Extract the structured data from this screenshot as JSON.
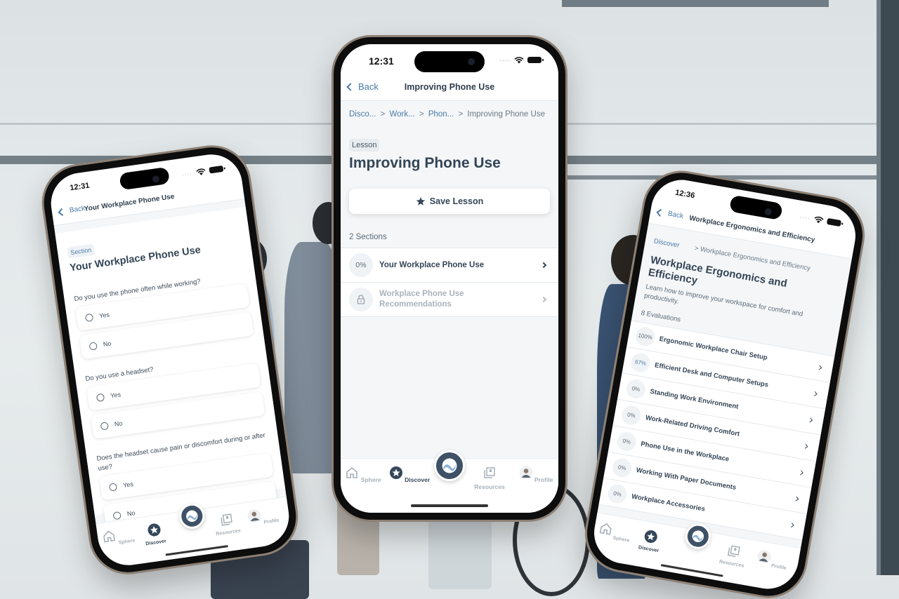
{
  "colors": {
    "accent": "#4a7ba6",
    "primary_text": "#344556",
    "tab_active": "#35475a",
    "center_button": "#3e5166",
    "screen_bg": "#f4f6f8"
  },
  "center_phone": {
    "status_time": "12:31",
    "nav": {
      "back_label": "Back",
      "title": "Improving Phone Use"
    },
    "breadcrumb": [
      {
        "label": "Disco...",
        "link": true
      },
      {
        "label": "Work...",
        "link": true
      },
      {
        "label": "Phon...",
        "link": true
      },
      {
        "label": "Improving Phone Use",
        "link": false
      }
    ],
    "breadcrumb_separator": ">",
    "tag": "Lesson",
    "title": "Improving Phone Use",
    "save_button": {
      "icon": "star-icon",
      "label": "Save Lesson"
    },
    "sections_count": "2 Sections",
    "sections": [
      {
        "progress": "0%",
        "label": "Your Workplace Phone Use",
        "locked": false
      },
      {
        "progress": null,
        "icon": "lock-icon",
        "label": "Workplace Phone Use Recommendations",
        "locked": true
      }
    ],
    "tabbar": [
      {
        "icon": "home-icon",
        "label": "Sphere",
        "active": false
      },
      {
        "icon": "star-circle-icon",
        "label": "Discover",
        "active": true
      },
      {
        "icon": "resources-icon",
        "label": "Resources",
        "active": false
      },
      {
        "icon": "profile-avatar-icon",
        "label": "Profile",
        "active": false
      }
    ]
  },
  "left_phone": {
    "status_time": "12:31",
    "nav": {
      "back_label": "Back",
      "title": "Your Workplace Phone Use"
    },
    "tag": "Section",
    "title": "Your Workplace Phone Use",
    "questions": [
      {
        "text": "Do you use the phone often while working?",
        "options": [
          "Yes",
          "No"
        ]
      },
      {
        "text": "Do you use a headset?",
        "options": [
          "Yes",
          "No"
        ]
      },
      {
        "text": "Does the headset cause pain or discomfort during or after use?",
        "options": [
          "Yes",
          "No"
        ]
      }
    ],
    "tabbar": [
      {
        "icon": "home-icon",
        "label": "Sphere",
        "active": false
      },
      {
        "icon": "star-circle-icon",
        "label": "Discover",
        "active": true
      },
      {
        "icon": "resources-icon",
        "label": "Resources",
        "active": false
      },
      {
        "icon": "profile-avatar-icon",
        "label": "Profile",
        "active": false
      }
    ]
  },
  "right_phone": {
    "status_time": "12:36",
    "nav": {
      "back_label": "Back",
      "title": "Workplace Ergonomics and Efficiency"
    },
    "breadcrumb": [
      {
        "label": "Discover",
        "link": true
      },
      {
        "label": "> Workplace Ergonomics and Efficiency",
        "link": false
      }
    ],
    "title": "Workplace Ergonomics and Efficiency",
    "description": "Learn how to improve your workspace for comfort and productivity.",
    "evaluations_count": "8 Evaluations",
    "evaluations": [
      {
        "progress": "100%",
        "label": "Ergonomic Workplace Chair Setup"
      },
      {
        "progress": "67%",
        "label": "Efficient Desk and Computer Setups"
      },
      {
        "progress": "0%",
        "label": "Standing Work Environment"
      },
      {
        "progress": "0%",
        "label": "Work-Related Driving Comfort"
      },
      {
        "progress": "0%",
        "label": "Phone Use in the Workplace"
      },
      {
        "progress": "0%",
        "label": "Working With Paper Documents"
      },
      {
        "progress": "0%",
        "label": "Workplace Accessories"
      }
    ],
    "tabbar": [
      {
        "icon": "home-icon",
        "label": "Sphere",
        "active": false
      },
      {
        "icon": "star-circle-icon",
        "label": "Discover",
        "active": true
      },
      {
        "icon": "resources-icon",
        "label": "Resources",
        "active": false
      },
      {
        "icon": "profile-avatar-icon",
        "label": "Profile",
        "active": false
      }
    ]
  }
}
